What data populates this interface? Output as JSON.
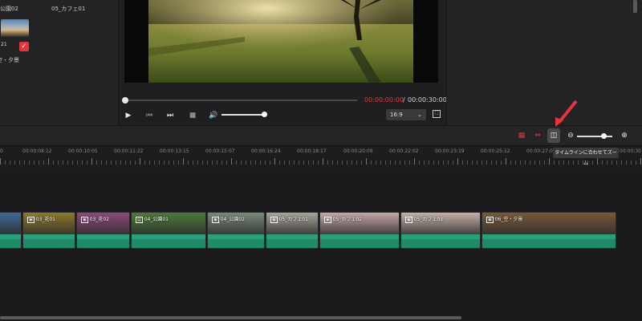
{
  "media": {
    "items": [
      {
        "name": "公園02"
      },
      {
        "name": "05_カフェ01"
      },
      {
        "name": "空・夕景",
        "duration": "21"
      }
    ]
  },
  "player": {
    "current_time": "00:00:00:00",
    "separator": "/",
    "total_time": "00:00:30:00",
    "aspect_ratio": "16:9",
    "progress": 0,
    "volume": 0.95
  },
  "toolbar": {
    "tooltip": "タイムラインに合わせてズーム",
    "zoom_level": 0.75
  },
  "ruler": {
    "labels": [
      "0",
      "00:00:08:12",
      "00:00:10:05",
      "00:00:11:22",
      "00:00:13:15",
      "00:00:15:07",
      "00:00:16:24",
      "00:00:18:17",
      "00:00:20:09",
      "00:00:22:02",
      "00:00:23:19",
      "00:00:25:12",
      "00:00:27:04",
      "00:00:30"
    ]
  },
  "clips": [
    {
      "label": "",
      "type": "image",
      "tone": "#3e6a95"
    },
    {
      "label": "03_花01",
      "type": "image",
      "tone": "#8e7a2a"
    },
    {
      "label": "03_花02",
      "type": "image",
      "tone": "#8c4a7a"
    },
    {
      "label": "04_公園01",
      "type": "video",
      "tone": "#4d7a3a"
    },
    {
      "label": "04_公園02",
      "type": "image",
      "tone": "#7a8a7a"
    },
    {
      "label": "05_カフェ01",
      "type": "image",
      "tone": "#a8a59a"
    },
    {
      "label": "05_カフェ02",
      "type": "image",
      "tone": "#c8a8a8"
    },
    {
      "label": "05_カフェ03",
      "type": "image",
      "tone": "#c6b2a8"
    },
    {
      "label": "06_空・夕景",
      "type": "image",
      "tone": "#7a5a3a"
    }
  ],
  "colors": {
    "accent": "#e5343b",
    "clip_green": "#2aa07a"
  }
}
